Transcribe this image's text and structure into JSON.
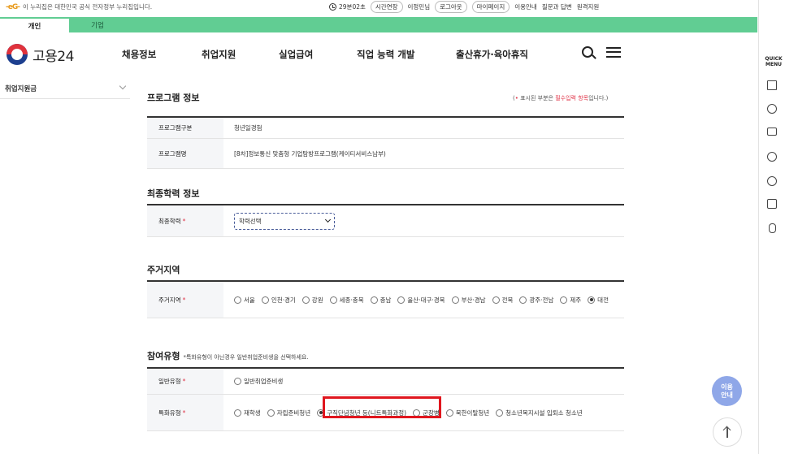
{
  "topbar": {
    "gov_logo": "-eG-",
    "notice": "이 누리집은 대한민국 공식 전자정부 누리집입니다.",
    "timer": "29분02초",
    "extend": "시간연장",
    "user": "이정민님",
    "logout": "로그아웃",
    "mypage": "마이페이지",
    "guide": "이용안내",
    "qna": "질문과 답변",
    "remote": "원격지원"
  },
  "tabs": {
    "personal": "개인",
    "business": "기업"
  },
  "header": {
    "brand": "고용24",
    "nav": [
      "채용정보",
      "취업지원",
      "실업급여",
      "직업 능력 개발",
      "출산휴가·육아휴직"
    ]
  },
  "sidebar": {
    "item": "취업지원금"
  },
  "program": {
    "title": "프로그램 정보",
    "req_prefix": "(",
    "req_star": "•",
    "req_mid": " 표시된 부분은 ",
    "req_red": "필수입력 항목",
    "req_suffix": "입니다.)",
    "type_label": "프로그램구분",
    "type_value": "청년일경험",
    "name_label": "프로그램명",
    "name_value": "[8차]정보통신 맞춤형 기업탐방프로그램(케이티서비스남부)"
  },
  "education": {
    "title": "최종학력 정보",
    "label": "최종학력",
    "star": "*",
    "select_value": "학력선택"
  },
  "residence": {
    "title": "주거지역",
    "label": "주거지역",
    "star": "*",
    "options": [
      "서울",
      "인천·경기",
      "강원",
      "세종·충북",
      "충남",
      "울산·대구·경북",
      "부산·경남",
      "전북",
      "광주·전남",
      "제주",
      "대전"
    ],
    "selected": "대전"
  },
  "participation": {
    "title": "참여유형",
    "note": "*특화유형이 아닌경우 일반취업준비생을 선택하세요.",
    "general_label": "일반유형",
    "general_star": "*",
    "general_option": "일반취업준비생",
    "special_label": "특화유형",
    "special_star": "*",
    "special_options": [
      "재학생",
      "자립준비청년",
      "구직단념청년 등(니트특화과정)",
      "군장병",
      "북한이탈청년",
      "청소년복지시설 입퇴소 청소년"
    ],
    "special_selected": "구직단념청년 등(니트특화과정)"
  },
  "quick_menu": {
    "title_line1": "QUICK",
    "title_line2": "MENU"
  },
  "floating": {
    "guide_line1": "이용",
    "guide_line2": "안내"
  }
}
